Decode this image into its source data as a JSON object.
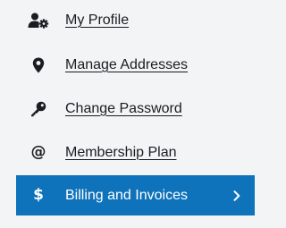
{
  "menu": {
    "items": [
      {
        "label": "My Profile",
        "icon": "user-gear-icon"
      },
      {
        "label": "Manage Addresses",
        "icon": "map-marker-icon"
      },
      {
        "label": "Change Password",
        "icon": "key-icon"
      },
      {
        "label": "Membership Plan",
        "icon": "at-sign-icon",
        "glyph": "@"
      },
      {
        "label": "Billing and Invoices",
        "icon": "dollar-icon",
        "glyph": "$",
        "active": true
      }
    ]
  },
  "colors": {
    "background": "#f3f4f5",
    "text": "#1c1c20",
    "active_background": "#0e73bb",
    "active_text": "#ffffff"
  }
}
